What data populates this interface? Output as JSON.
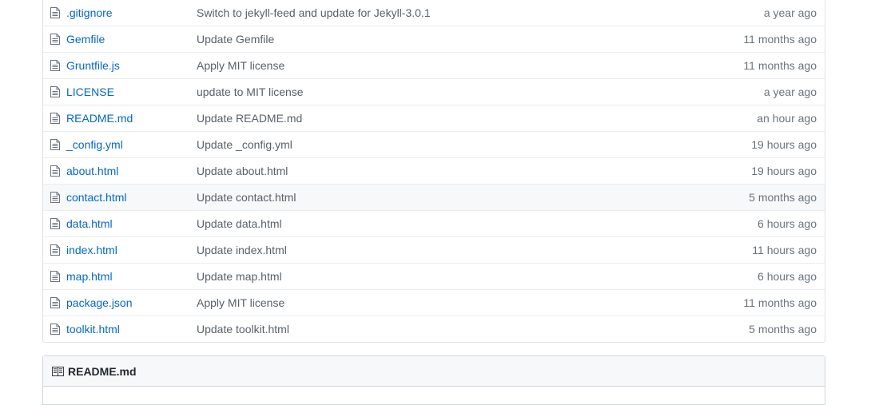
{
  "files": [
    {
      "name": ".gitignore",
      "message": "Switch to jekyll-feed and update for Jekyll-3.0.1",
      "age": "a year ago",
      "highlight": false
    },
    {
      "name": "Gemfile",
      "message": "Update Gemfile",
      "age": "11 months ago",
      "highlight": false
    },
    {
      "name": "Gruntfile.js",
      "message": "Apply MIT license",
      "age": "11 months ago",
      "highlight": false
    },
    {
      "name": "LICENSE",
      "message": "update to MIT license",
      "age": "a year ago",
      "highlight": false
    },
    {
      "name": "README.md",
      "message": "Update README.md",
      "age": "an hour ago",
      "highlight": false
    },
    {
      "name": "_config.yml",
      "message": "Update _config.yml",
      "age": "19 hours ago",
      "highlight": false
    },
    {
      "name": "about.html",
      "message": "Update about.html",
      "age": "19 hours ago",
      "highlight": false
    },
    {
      "name": "contact.html",
      "message": "Update contact.html",
      "age": "5 months ago",
      "highlight": true
    },
    {
      "name": "data.html",
      "message": "Update data.html",
      "age": "6 hours ago",
      "highlight": false
    },
    {
      "name": "index.html",
      "message": "Update index.html",
      "age": "11 hours ago",
      "highlight": false
    },
    {
      "name": "map.html",
      "message": "Update map.html",
      "age": "6 hours ago",
      "highlight": false
    },
    {
      "name": "package.json",
      "message": "Apply MIT license",
      "age": "11 months ago",
      "highlight": false
    },
    {
      "name": "toolkit.html",
      "message": "Update toolkit.html",
      "age": "5 months ago",
      "highlight": false
    }
  ],
  "readme": {
    "title": "README.md",
    "icon": "book-icon"
  },
  "colors": {
    "link": "#0366d6",
    "message": "#586069",
    "age": "#6a737d",
    "border": "#dfe2e5",
    "highlight": "#f6f8fa"
  }
}
